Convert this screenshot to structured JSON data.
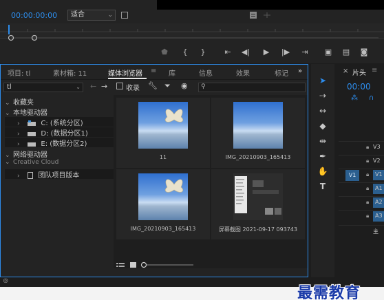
{
  "monitor": {
    "timecode": "00:00:00:00",
    "fit_label": "适合"
  },
  "project_panel": {
    "tabs": [
      {
        "label": "项目: tl"
      },
      {
        "label": "素材箱: 11"
      },
      {
        "label": "媒体浏览器"
      },
      {
        "label": "库"
      },
      {
        "label": "信息"
      },
      {
        "label": "效果"
      },
      {
        "label": "标记"
      }
    ],
    "active_tab": "媒体浏览器",
    "filter_value": "tl",
    "ingest_label": "收录",
    "search_placeholder": "",
    "tree": {
      "favorites": "收藏夹",
      "local_drives": "本地驱动器",
      "drives": [
        {
          "label": "C: (系统分区)"
        },
        {
          "label": "D: (数据分区1)"
        },
        {
          "label": "E: (数据分区2)"
        }
      ],
      "network_drives": "网络驱动器",
      "creative_cloud": "Creative Cloud",
      "team_project": "团队项目版本"
    },
    "items": [
      {
        "label": "11"
      },
      {
        "label": "IMG_20210903_165413"
      },
      {
        "label": "IMG_20210903_165413"
      },
      {
        "label": "屏幕截图 2021-09-17 093743"
      }
    ]
  },
  "timeline": {
    "tab_label": "片头",
    "timecode": "00:00",
    "tracks": [
      "V3",
      "V2",
      "V1",
      "A1",
      "A2",
      "A3",
      "主"
    ],
    "source_patch": "V1"
  },
  "watermark": "最需教育",
  "colors": {
    "accent": "#2d8ceb",
    "panel_bg": "#232323"
  }
}
